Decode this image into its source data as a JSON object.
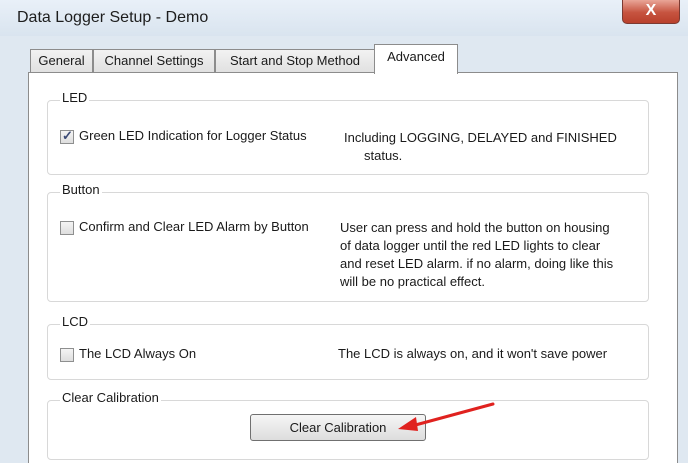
{
  "window": {
    "title": "Data Logger Setup - Demo",
    "close_label": "X"
  },
  "tabs": [
    {
      "label": "General",
      "active": false
    },
    {
      "label": "Channel Settings",
      "active": false
    },
    {
      "label": "Start and Stop Method",
      "active": false
    },
    {
      "label": "Advanced",
      "active": true
    }
  ],
  "groups": {
    "led": {
      "title": "LED",
      "checkbox_label": "Green LED Indication for Logger Status",
      "checked": true,
      "desc_line1": "Including LOGGING, DELAYED and FINISHED",
      "desc_line2": "status."
    },
    "button": {
      "title": "Button",
      "checkbox_label": "Confirm and Clear LED Alarm by Button",
      "checked": false,
      "desc_line1": "User can press and hold the button on housing",
      "desc_line2": "of data logger until the red LED lights to clear",
      "desc_line3": "and reset LED alarm. if no alarm, doing like this",
      "desc_line4": "will be no practical effect."
    },
    "lcd": {
      "title": "LCD",
      "checkbox_label": "The LCD Always On",
      "checked": false,
      "desc": "The LCD is always on, and it won't save power"
    },
    "calibration": {
      "title": "Clear Calibration",
      "button_label": "Clear Calibration"
    }
  },
  "colors": {
    "annotation_arrow": "#e0221f",
    "close_button": "#c6533f"
  },
  "icons": {
    "checkmark": "✓"
  }
}
